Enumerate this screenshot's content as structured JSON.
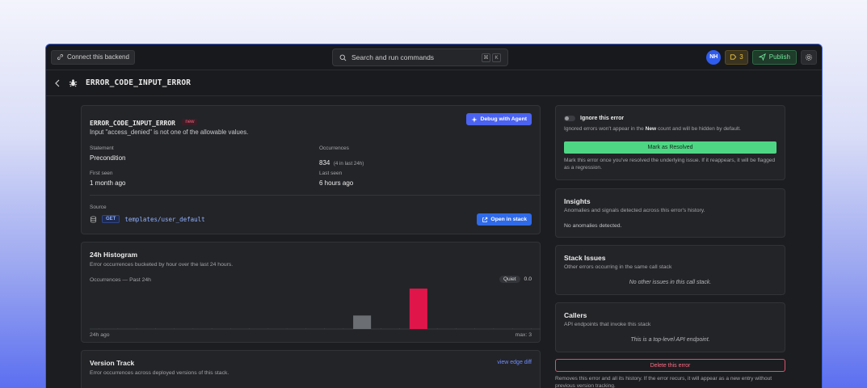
{
  "topbar": {
    "connect_label": "Connect this backend",
    "search_placeholder": "Search and run commands",
    "shortcut_keys": [
      "⌘",
      "K"
    ],
    "avatar_initials": "NH",
    "notification_count": "3",
    "publish_label": "Publish"
  },
  "subheader": {
    "title": "ERROR_CODE_INPUT_ERROR"
  },
  "error_card": {
    "code": "ERROR_CODE_INPUT_ERROR",
    "tag": "new",
    "message": "Input \"access_denied\" is not one of the allowable values.",
    "debug_label": "Debug with Agent",
    "statement_label": "Statement",
    "statement_value": "Precondition",
    "occurrences_label": "Occurrences",
    "occurrences_value": "834",
    "occurrences_recent": "(4 in last 24h)",
    "first_seen_label": "First seen",
    "first_seen_value": "1 month ago",
    "last_seen_label": "Last seen",
    "last_seen_value": "6 hours ago",
    "source_label": "Source",
    "method": "GET",
    "path": "templates/user_default",
    "open_label": "Open in stack"
  },
  "histogram": {
    "title": "24h Histogram",
    "description": "Error occurrences bucketed by hour over the last 24 hours.",
    "occ_label": "Occurrences — Past 24h",
    "status": "Quiet",
    "status_value": "0.0",
    "start_label": "24h ago",
    "max_label": "max: 3"
  },
  "chart_data": {
    "type": "bar",
    "title": "24h Histogram",
    "x": [
      1,
      2,
      3,
      4,
      5,
      6,
      7,
      8,
      9,
      10,
      11,
      12,
      13,
      14,
      15,
      16,
      17,
      18,
      19,
      20,
      21,
      22,
      23,
      24
    ],
    "values": [
      0,
      0,
      0,
      0,
      0,
      0,
      0,
      0,
      0,
      0,
      0,
      0,
      0,
      0,
      1,
      0,
      0,
      3,
      0,
      0,
      0,
      0,
      0,
      0
    ],
    "bar_colors": {
      "15": "#6b6e73",
      "18": "#e0164b"
    },
    "ylim": [
      0,
      3
    ],
    "grid": false
  },
  "version_track": {
    "title": "Version Track",
    "description": "Error occurrences across deployed versions of this stack.",
    "link_label": "view edge diff"
  },
  "ignore_card": {
    "title": "Ignore this error",
    "desc_before": "Ignored errors won't appear in the ",
    "desc_bold": "New",
    "desc_after": " count and will be hidden by default.",
    "resolve_label": "Mark as Resolved",
    "resolve_desc": "Mark this error once you've resolved the underlying issue. If it reappears, it will be flagged as a regression."
  },
  "insights": {
    "title": "Insights",
    "description": "Anomalies and signals detected across this error's history.",
    "empty": "No anomalies detected."
  },
  "stack_issues": {
    "title": "Stack Issues",
    "description": "Other errors occurring in the same call stack",
    "empty": "No other issues in this call stack."
  },
  "callers": {
    "title": "Callers",
    "description": "API endpoints that invoke this stack",
    "empty": "This is a top-level API endpoint."
  },
  "delete": {
    "label": "Delete this error",
    "description": "Removes this error and all its history. If the error recurs, it will appear as a new entry without previous version tracking."
  },
  "colors": {
    "accent": "#4a6cf7",
    "success": "#4fd685",
    "danger": "#e0164b",
    "frame": "#3e62e6"
  }
}
